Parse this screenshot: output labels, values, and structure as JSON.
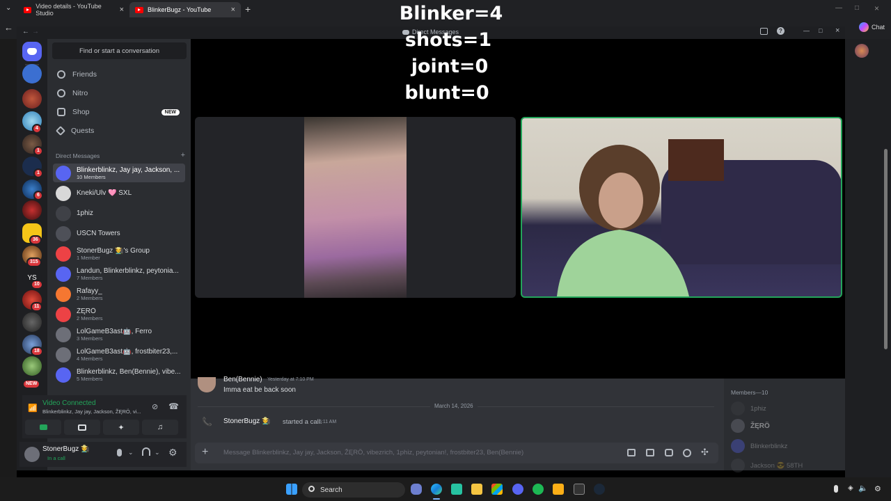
{
  "browser": {
    "tabs": [
      {
        "label": "Video details - YouTube Studio"
      },
      {
        "label": "BlinkerBugz - YouTube"
      }
    ],
    "copilot_label": "Chat"
  },
  "discord": {
    "window_title": "Direct Messages",
    "search_placeholder": "Find or start a conversation",
    "nav": [
      {
        "label": "Friends",
        "icon": "friends-icon"
      },
      {
        "label": "Nitro",
        "icon": "nitro-icon"
      },
      {
        "label": "Shop",
        "icon": "shop-icon",
        "badge": "NEW"
      },
      {
        "label": "Quests",
        "icon": "quests-icon"
      }
    ],
    "dm_header": "Direct Messages",
    "dm_add": "+",
    "dms": [
      {
        "name": "Blinkerblinkz, Jay jay, Jackson, ...",
        "sub": "10 Members",
        "color": "#5865f2",
        "selected": true
      },
      {
        "name": "Kneki/Ulv 🩷 SXL",
        "sub": "",
        "color": "#6d6f78"
      },
      {
        "name": "1phiz",
        "sub": "",
        "color": "#3f4147"
      },
      {
        "name": "USCN Towers",
        "sub": "",
        "color": "#4e5058"
      },
      {
        "name": "StonerBugz 🧑‍🌾's Group",
        "sub": "1 Member",
        "color": "#ed4245"
      },
      {
        "name": "Landun, Blinkerblinkz, peytonia...",
        "sub": "7 Members",
        "color": "#5865f2"
      },
      {
        "name": "Rafayy_",
        "sub": "2 Members",
        "color": "#f57731"
      },
      {
        "name": "ŽĘRÖ",
        "sub": "2 Members",
        "color": "#ed4245"
      },
      {
        "name": "LolGameB3ast🤖, Ferro",
        "sub": "3 Members",
        "color": "#6d6f78"
      },
      {
        "name": "LolGameB3ast🤖, frostbiter23,...",
        "sub": "4 Members",
        "color": "#6d6f78"
      },
      {
        "name": "Blinkerblinkz, Ben(Bennie), vibe...",
        "sub": "5 Members",
        "color": "#5865f2"
      }
    ],
    "guild_badges": [
      "4",
      "1",
      "1",
      "6",
      "36",
      "315",
      "10",
      "11",
      "18"
    ],
    "guild_label_ys": "YS",
    "guild_new": "NEW",
    "voice": {
      "status": "Video Connected",
      "channel": "Blinkerblinkz, Jay jay, Jackson, ŽĘRÖ, vi..."
    },
    "user": {
      "name": "StonerBugz 🧑‍🌾",
      "status": "In a call"
    },
    "overlay": [
      "Blinker=4",
      "shots=1",
      "joint=0",
      "blunt=0"
    ],
    "chat": {
      "msg_author": "Ben(Bennie)",
      "msg_time": "Yesterday at 7:10 PM",
      "msg_text": "Imma eat be back soon",
      "date_divider": "March 14, 2026",
      "call_user": "StonerBugz 🧑‍🌾",
      "call_text": "started a call.",
      "call_time": "5:11 AM",
      "composer_placeholder": "Message Blinkerblinkz, Jay jay, Jackson, ŽĘRÖ, vibezrich, 1phiz, peytonian!, frostbiter23, Ben(Bennie)"
    },
    "members": {
      "header": "Members—10",
      "names": [
        "1phiz",
        "ŽĘRÖ",
        "Blinkerblinkz",
        "Jackson 😎 58TH"
      ]
    }
  },
  "taskbar": {
    "search_label": "Search"
  },
  "colors": {
    "accent": "#5865f2",
    "online": "#23a55a",
    "danger": "#da373c"
  }
}
